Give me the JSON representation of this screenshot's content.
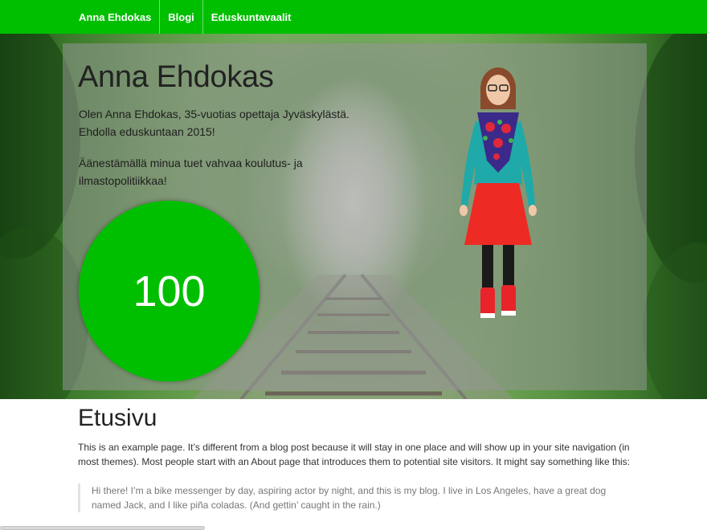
{
  "nav": {
    "items": [
      {
        "label": "Anna Ehdokas"
      },
      {
        "label": "Blogi"
      },
      {
        "label": "Eduskuntavaalit"
      }
    ]
  },
  "hero": {
    "title": "Anna Ehdokas",
    "intro": "Olen Anna Ehdokas, 35-vuotias opettaja Jyväskylästä. Ehdolla eduskuntaan 2015!",
    "pitch": "Äänestämällä minua tuet vahvaa koulutus- ja ilmastopolitiikkaa!",
    "counter": "100"
  },
  "page": {
    "title": "Etusivu",
    "body": "This is an example page. It’s different from a blog post because it will stay in one place and will show up in your site navigation (in most themes). Most people start with an About page that introduces them to potential site visitors. It might say something like this:",
    "quote": "Hi there! I’m a bike messenger by day, aspiring actor by night, and this is my blog. I live in Los Angeles, have a great dog named Jack, and I like piña coladas. (And gettin’ caught in the rain.)"
  },
  "colors": {
    "brand_green": "#00bf00",
    "overlay_gray": "#969696"
  }
}
